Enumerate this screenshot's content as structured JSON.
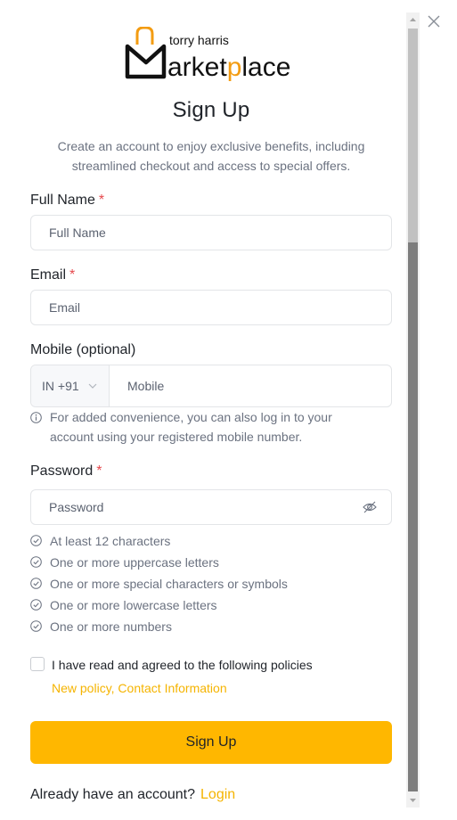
{
  "brand": {
    "small": "torry harris",
    "large_m": "M",
    "large_rest_1": "arket",
    "large_p": "p",
    "large_rest_2": "lace"
  },
  "title": "Sign Up",
  "subtitle": "Create an account to enjoy exclusive benefits, including streamlined checkout and access to special offers.",
  "fields": {
    "full_name": {
      "label": "Full Name",
      "required": "*",
      "placeholder": "Full Name"
    },
    "email": {
      "label": "Email",
      "required": "*",
      "placeholder": "Email"
    },
    "mobile": {
      "label": "Mobile (optional)",
      "country_code": "IN +91",
      "placeholder": "Mobile",
      "hint": "For added convenience, you can also log in to your account using your registered mobile number."
    },
    "password": {
      "label": "Password",
      "required": "*",
      "placeholder": "Password"
    }
  },
  "password_rules": [
    "At least 12 characters",
    "One or more uppercase letters",
    "One or more special characters or symbols",
    "One or more lowercase letters",
    "One or more numbers"
  ],
  "agreement": {
    "text": "I have read and agreed to the following policies",
    "policies_link": "New policy, Contact Information",
    "checked": false
  },
  "signup_button": "Sign Up",
  "footer": {
    "prompt": "Already have an account?",
    "login_link": "Login"
  },
  "icons": {
    "close": "close-icon",
    "eye": "eye-off-icon",
    "info": "info-icon",
    "check": "check-circle-icon",
    "chevron": "chevron-down-icon"
  },
  "colors": {
    "accent": "#ffb700",
    "link": "#f5b400",
    "required": "#e5484d",
    "logo_orange": "#f39c12"
  }
}
